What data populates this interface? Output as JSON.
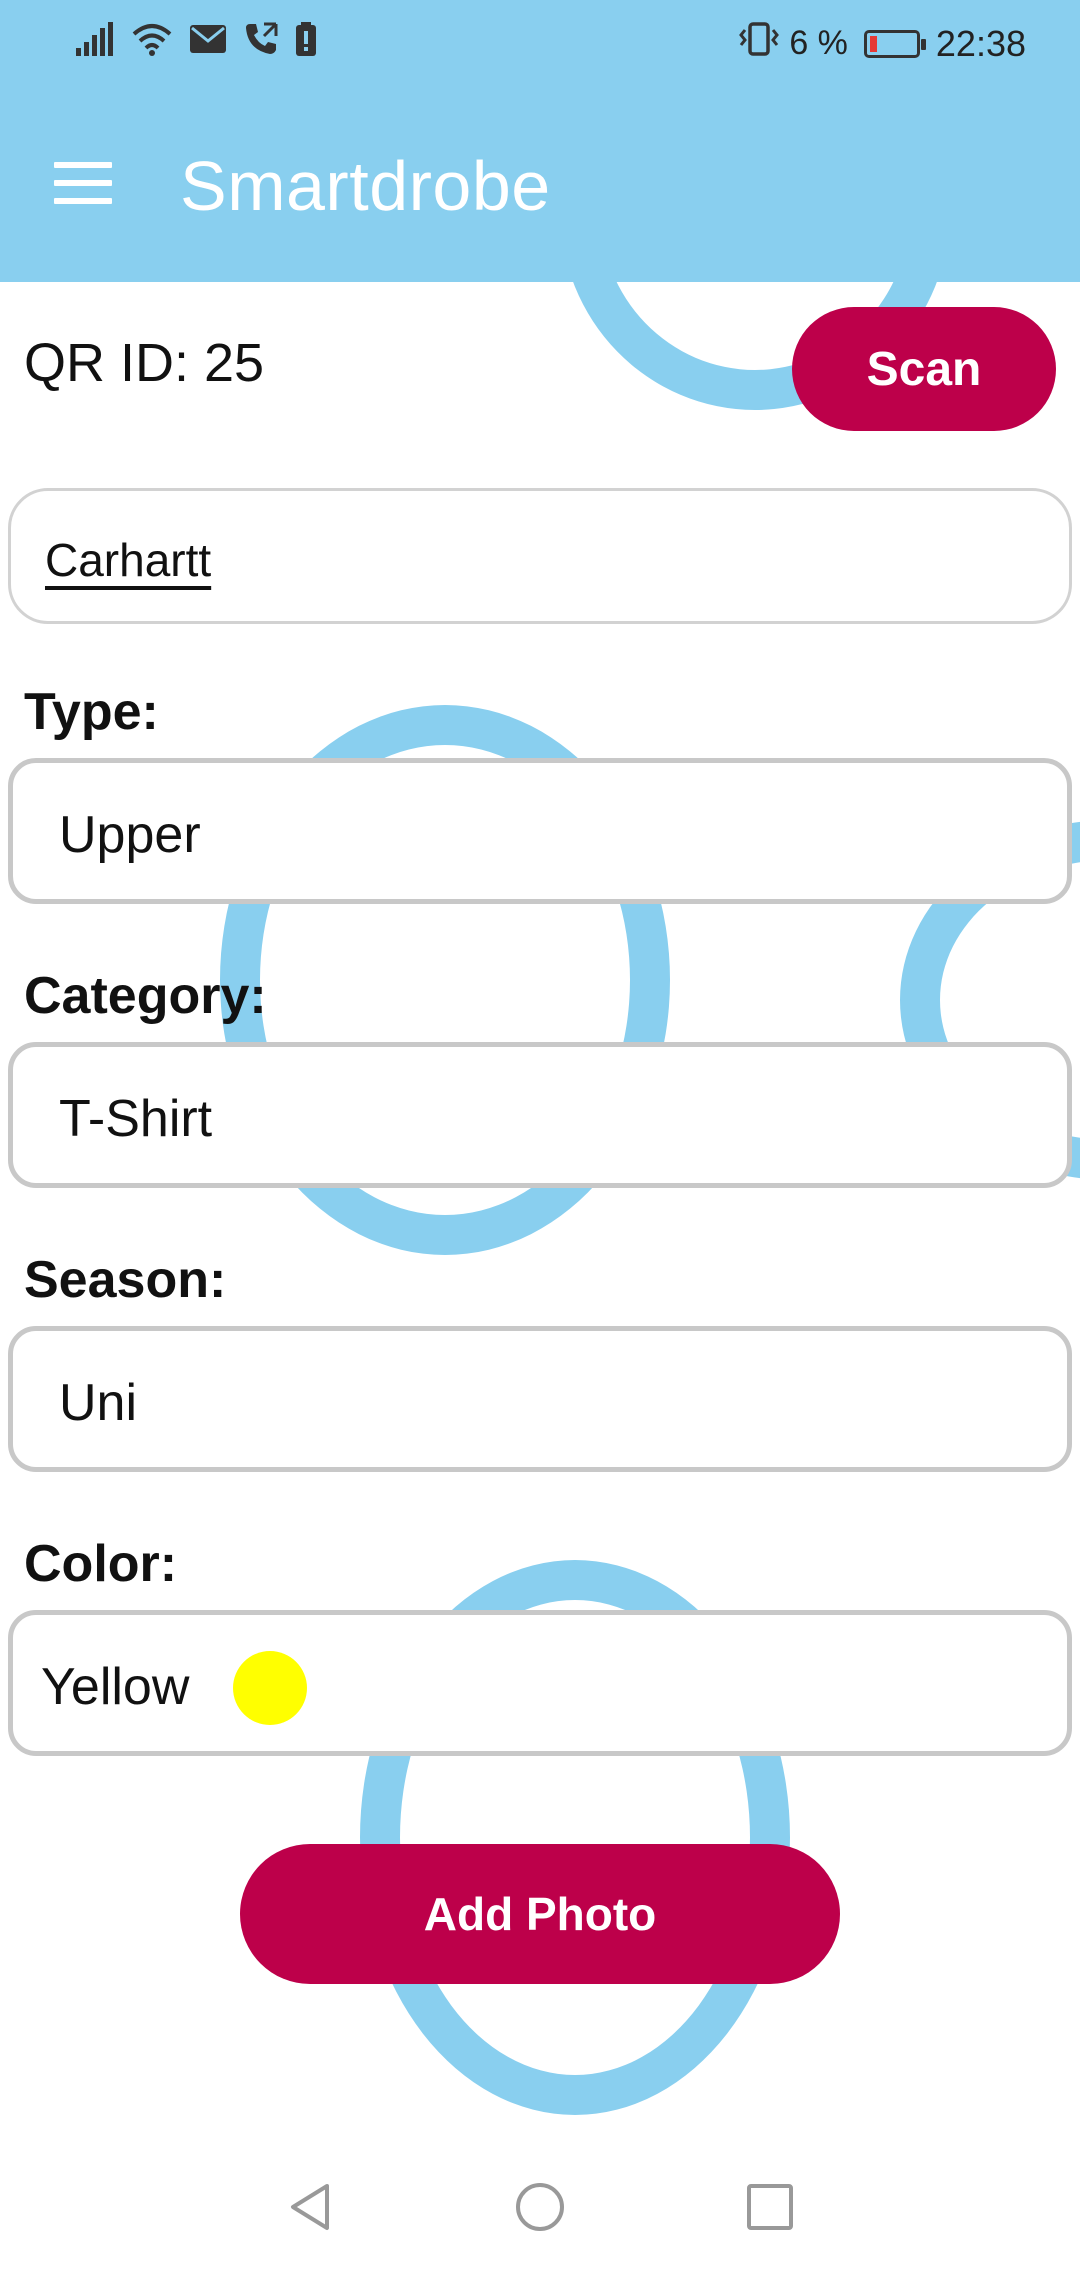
{
  "status_bar": {
    "battery_percent": "6 %",
    "time": "22:38",
    "icons": [
      "signal-icon",
      "wifi-icon",
      "mail-icon",
      "call-icon",
      "battery-alert-icon",
      "vibrate-icon",
      "battery-icon"
    ],
    "battery_fill": 0.06
  },
  "app_bar": {
    "title": "Smartdrobe",
    "menu_icon": "hamburger-menu-icon",
    "background": "#89cfef"
  },
  "qr": {
    "label": "QR ID: 25",
    "scan_label": "Scan"
  },
  "brand": {
    "value": "Carhartt"
  },
  "fields": {
    "type": {
      "label": "Type:",
      "value": "Upper"
    },
    "category": {
      "label": "Category:",
      "value": "T-Shirt"
    },
    "season": {
      "label": "Season:",
      "value": "Uni"
    },
    "color": {
      "label": "Color:",
      "value": "Yellow",
      "swatch": "#ffff00"
    }
  },
  "actions": {
    "add_photo_label": "Add Photo"
  },
  "colors": {
    "accent": "#bd004a",
    "ring": "#89cfef"
  },
  "nav": {
    "icons": [
      "back-icon",
      "home-icon",
      "recents-icon"
    ]
  }
}
